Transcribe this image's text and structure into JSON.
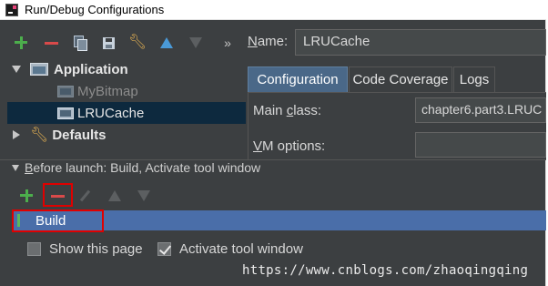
{
  "window": {
    "title": "Run/Debug Configurations"
  },
  "toolbar": {
    "buttons": [
      "add-icon",
      "remove-icon",
      "copy-icon",
      "save-icon",
      "edit-defaults-icon",
      "move-up-icon",
      "move-down-icon"
    ],
    "more_label": "»"
  },
  "tree": {
    "application": {
      "label": "Application",
      "expanded": true
    },
    "children": [
      {
        "label": "MyBitmap",
        "selected": false
      },
      {
        "label": "LRUCache",
        "selected": true
      }
    ],
    "defaults": {
      "label": "Defaults",
      "expanded": false
    }
  },
  "name_field": {
    "label_prefix": "N",
    "label_rest": "ame:",
    "value": "LRUCache"
  },
  "tabs": [
    {
      "label": "Configuration",
      "active": true
    },
    {
      "label": "Code Coverage",
      "active": false
    },
    {
      "label": "Logs",
      "active": false
    }
  ],
  "config": {
    "main_class": {
      "label_prefix": "Main ",
      "label_underlined": "c",
      "label_rest": "lass:",
      "value": "chapter6.part3.LRUC"
    },
    "vm_options": {
      "label_underlined": "V",
      "label_rest": "M options:",
      "value": ""
    }
  },
  "before_launch": {
    "header_underlined": "B",
    "header_rest": "efore launch: Build, Activate tool window",
    "items": [
      {
        "label": "Build",
        "icon": "build-icon"
      }
    ],
    "build_icon_text": "01\n10\n01"
  },
  "checkboxes": {
    "show_this_page": {
      "label": "Show this page",
      "checked": false
    },
    "activate_tool_window": {
      "label": "Activate tool window",
      "checked": true
    }
  },
  "watermark": "https://www.cnblogs.com/zhaoqingqing",
  "colors": {
    "background": "#3c3f41",
    "selection": "#0d293e",
    "list_selection": "#4a6ea9",
    "active_tab": "#4a6888",
    "highlight_box": "#e00000",
    "add_green": "#4cae4c",
    "remove_red": "#d94a4a"
  }
}
